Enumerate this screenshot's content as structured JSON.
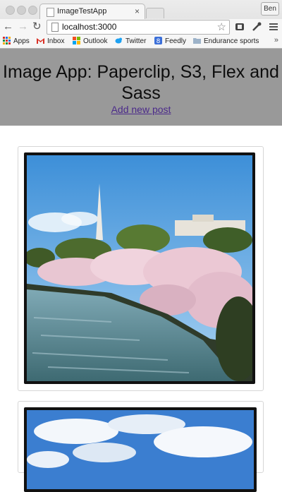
{
  "browser": {
    "tab_title": "ImageTestApp",
    "tab_close": "×",
    "profile_name": "Ben",
    "url": "localhost:3000",
    "bookmarks": {
      "apps": "Apps",
      "inbox": "Inbox",
      "outlook": "Outlook",
      "twitter": "Twitter",
      "feedly": "Feedly",
      "endurance": "Endurance sports",
      "more": "»"
    }
  },
  "page": {
    "title": "Image App: Paperclip, S3, Flex and Sass",
    "add_post_link": "Add new post"
  },
  "colors": {
    "header_bg": "#999999",
    "link": "#4b2a8a"
  }
}
